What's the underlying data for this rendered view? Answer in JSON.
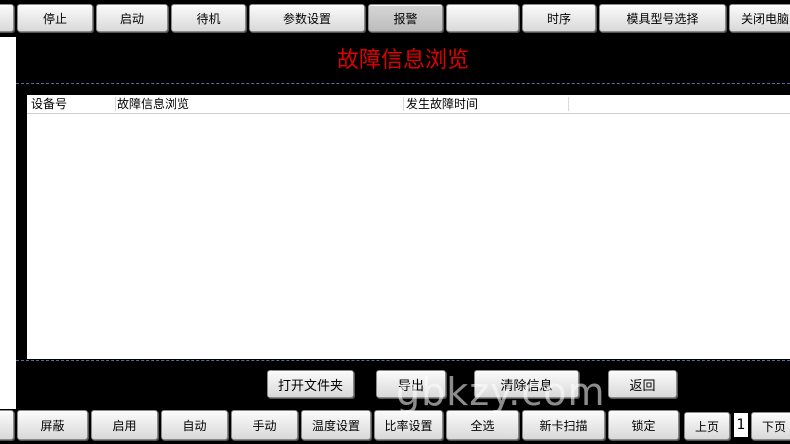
{
  "top_toolbar": {
    "buttons": [
      "停止",
      "启动",
      "待机",
      "参数设置",
      "报警",
      "",
      "时序",
      "模具型号选择",
      "关闭电脑"
    ]
  },
  "page_title": "故障信息浏览",
  "table": {
    "columns": [
      "设备号",
      "故障信息浏览",
      "发生故障时间"
    ],
    "rows": []
  },
  "actions": {
    "open_folder": "打开文件夹",
    "export": "导出",
    "clear": "清除信息",
    "back": "返回"
  },
  "bottom_toolbar": {
    "buttons": [
      "屏蔽",
      "启用",
      "自动",
      "手动",
      "温度设置",
      "比率设置",
      "全选",
      "新卡扫描",
      "锁定"
    ],
    "prev_page": "上页",
    "page_number": "1",
    "next_page": "下页"
  },
  "watermark": "gbkzy.com",
  "colors": {
    "title": "#e00000",
    "background": "#000000",
    "button_face": "#e8e8e8"
  }
}
